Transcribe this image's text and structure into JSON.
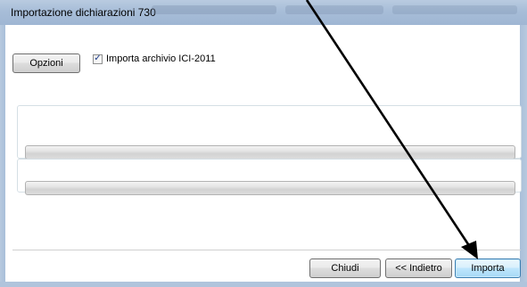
{
  "window": {
    "title": "Importazione dichiarazioni 730"
  },
  "options": {
    "button_label": "Opzioni",
    "import_ici_checkbox": {
      "label": "Importa archivio ICI-2011",
      "checked": true
    }
  },
  "progress": {
    "bar1_level": 0,
    "bar2_level": 0
  },
  "footer": {
    "close_label": "Chiudi",
    "back_label": "<< Indietro",
    "import_label": "Importa"
  },
  "colors": {
    "titlebar": "#a7bdd8",
    "default_button_border": "#3c7fb1",
    "annotation_arrow": "#000000"
  },
  "icons": {
    "checkbox_mark": "checkmark-icon",
    "annotation": "arrow-annotation"
  }
}
